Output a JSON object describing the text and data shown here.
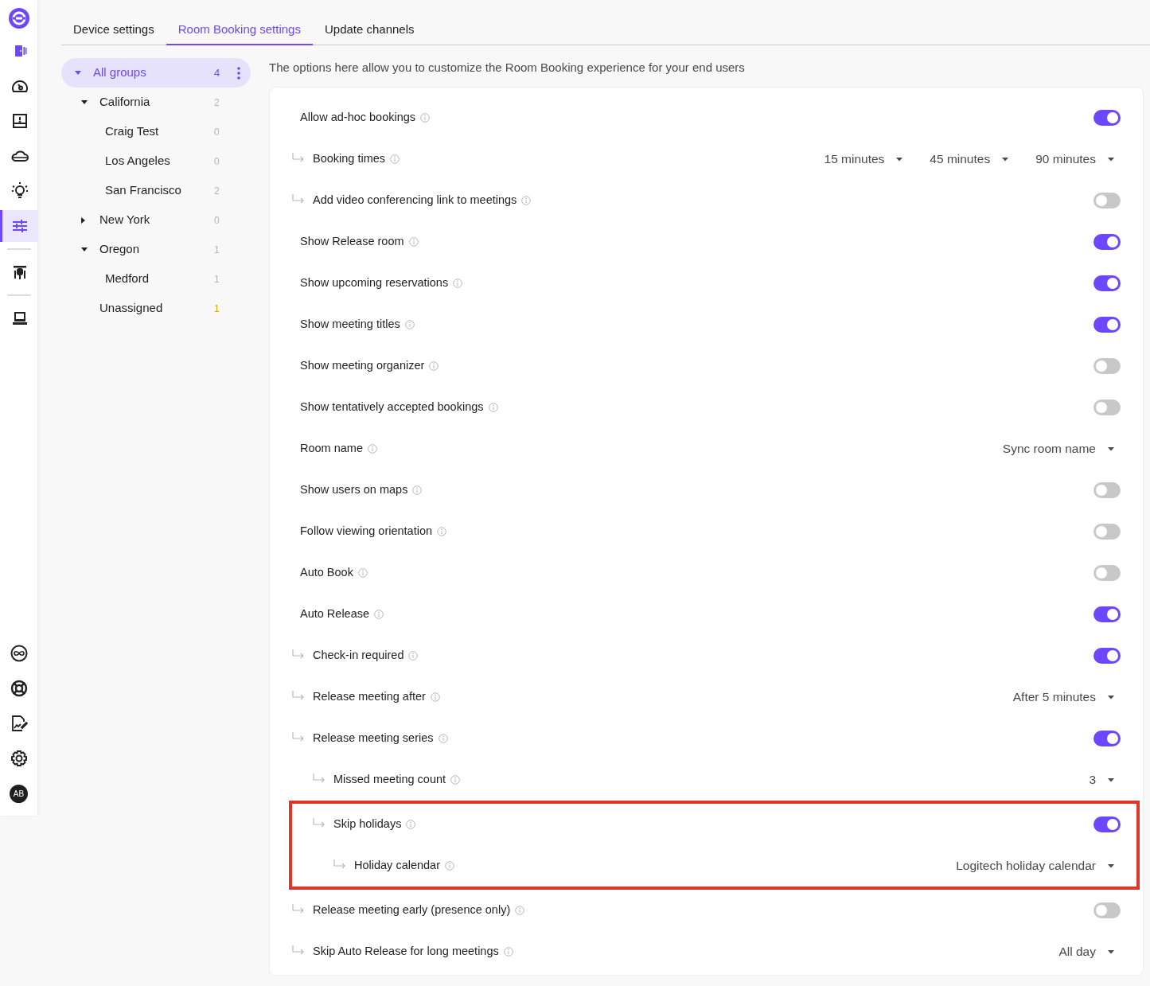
{
  "sidebar": {
    "items": [
      {
        "selected": false
      },
      {
        "selected": false
      },
      {
        "selected": false
      },
      {
        "selected": false
      },
      {
        "selected": false
      },
      {
        "selected": true
      },
      {
        "selected": false
      },
      {
        "selected": false
      }
    ],
    "avatar": "AB"
  },
  "tabs": [
    {
      "label": "Device settings",
      "selected": false
    },
    {
      "label": "Room Booking settings",
      "selected": true
    },
    {
      "label": "Update channels",
      "selected": false
    }
  ],
  "groups": [
    {
      "label": "All groups",
      "count": "4",
      "selected": true,
      "expanded": true,
      "alert": false,
      "children": [
        {
          "label": "California",
          "count": "2",
          "selected": false,
          "expanded": true,
          "alert": false,
          "children": [
            {
              "label": "Craig Test",
              "count": "0",
              "selected": false,
              "alert": false
            },
            {
              "label": "Los Angeles",
              "count": "0",
              "selected": false,
              "alert": false
            },
            {
              "label": "San Francisco",
              "count": "2",
              "selected": false,
              "alert": false
            }
          ]
        },
        {
          "label": "New York",
          "count": "0",
          "selected": false,
          "expanded": false,
          "alert": false
        },
        {
          "label": "Oregon",
          "count": "1",
          "selected": false,
          "expanded": true,
          "alert": false,
          "children": [
            {
              "label": "Medford",
              "count": "1",
              "selected": false,
              "alert": false
            }
          ]
        },
        {
          "label": "Unassigned",
          "count": "1",
          "selected": false,
          "alert": true
        }
      ]
    }
  ],
  "description": "The options here allow you to customize the Room Booking experience for your end users",
  "settings": [
    {
      "label": "Allow ad-hoc bookings",
      "kind": "toggle",
      "on": true,
      "children": [
        {
          "label": "Booking times",
          "kind": "select",
          "values": [
            "15 minutes",
            "45 minutes",
            "90 minutes"
          ]
        },
        {
          "label": "Add video conferencing link to meetings",
          "kind": "toggle",
          "on": false
        }
      ]
    },
    {
      "label": "Show Release room",
      "kind": "toggle",
      "on": true
    },
    {
      "label": "Show upcoming reservations",
      "kind": "toggle",
      "on": true
    },
    {
      "label": "Show meeting titles",
      "kind": "toggle",
      "on": true
    },
    {
      "label": "Show meeting organizer",
      "kind": "toggle",
      "on": false
    },
    {
      "label": "Show tentatively accepted bookings",
      "kind": "toggle",
      "on": false
    },
    {
      "label": "Room name",
      "kind": "select",
      "values": [
        "Sync room name"
      ]
    },
    {
      "label": "Show users on maps",
      "kind": "toggle",
      "on": false
    },
    {
      "label": "Follow viewing orientation",
      "kind": "toggle",
      "on": false
    },
    {
      "label": "Auto Book",
      "kind": "toggle",
      "on": false
    },
    {
      "label": "Auto Release",
      "kind": "toggle",
      "on": true,
      "children": [
        {
          "label": "Check-in required",
          "kind": "toggle",
          "on": true
        },
        {
          "label": "Release meeting after",
          "kind": "select",
          "values": [
            "After 5 minutes"
          ]
        },
        {
          "label": "Release meeting series",
          "kind": "toggle",
          "on": true,
          "children": [
            {
              "label": "Missed meeting count",
              "kind": "select",
              "values": [
                "3"
              ]
            },
            {
              "label": "Skip holidays",
              "kind": "toggle",
              "on": true,
              "highlighted": true,
              "children": [
                {
                  "label": "Holiday calendar",
                  "kind": "select",
                  "values": [
                    "Logitech holiday calendar"
                  ]
                }
              ]
            }
          ]
        },
        {
          "label": "Release meeting early (presence only)",
          "kind": "toggle",
          "on": false
        },
        {
          "label": "Skip Auto Release for long meetings",
          "kind": "select",
          "values": [
            "All day"
          ]
        }
      ]
    }
  ]
}
